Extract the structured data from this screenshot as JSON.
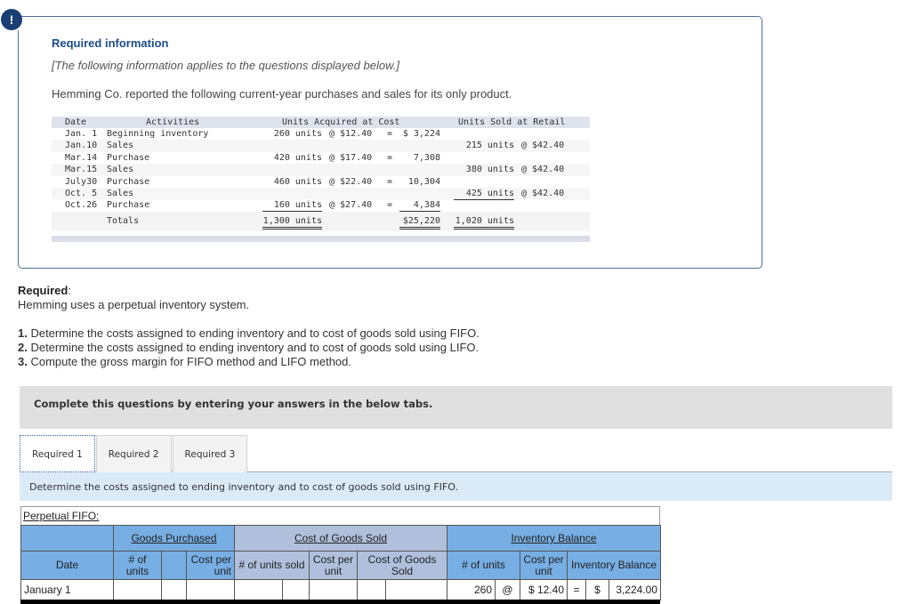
{
  "info": {
    "title": "Required information",
    "note": "[The following information applies to the questions displayed below.]",
    "intro": "Hemming Co. reported the following current-year purchases and sales for its only product."
  },
  "data_table": {
    "headers": {
      "date": "Date",
      "activities": "Activities",
      "acquired": "Units Acquired at Cost",
      "sold": "Units Sold at Retail"
    },
    "rows": [
      {
        "date": "Jan. 1",
        "activity": "Beginning inventory",
        "acq_units": "260 units",
        "acq_at": "@ $12.40",
        "acq_eq": "=",
        "acq_total": "$ 3,224",
        "sold_units": "",
        "sold_at": ""
      },
      {
        "date": "Jan.10",
        "activity": "Sales",
        "acq_units": "",
        "acq_at": "",
        "acq_eq": "",
        "acq_total": "",
        "sold_units": "215 units",
        "sold_at": "@ $42.40"
      },
      {
        "date": "Mar.14",
        "activity": "Purchase",
        "acq_units": "420 units",
        "acq_at": "@ $17.40",
        "acq_eq": "=",
        "acq_total": "7,308",
        "sold_units": "",
        "sold_at": ""
      },
      {
        "date": "Mar.15",
        "activity": "Sales",
        "acq_units": "",
        "acq_at": "",
        "acq_eq": "",
        "acq_total": "",
        "sold_units": "380 units",
        "sold_at": "@ $42.40"
      },
      {
        "date": "July30",
        "activity": "Purchase",
        "acq_units": "460 units",
        "acq_at": "@ $22.40",
        "acq_eq": "=",
        "acq_total": "10,304",
        "sold_units": "",
        "sold_at": ""
      },
      {
        "date": "Oct. 5",
        "activity": "Sales",
        "acq_units": "",
        "acq_at": "",
        "acq_eq": "",
        "acq_total": "",
        "sold_units": "425 units",
        "sold_at": "@ $42.40"
      },
      {
        "date": "Oct.26",
        "activity": "Purchase",
        "acq_units": "160 units",
        "acq_at": "@ $27.40",
        "acq_eq": "=",
        "acq_total": "4,384",
        "sold_units": "",
        "sold_at": ""
      }
    ],
    "totals": {
      "label": "Totals",
      "acq_units": "1,300 units",
      "acq_total": "$25,220",
      "sold_units": "1,020 units"
    }
  },
  "required": {
    "label": "Required",
    "colon": ":",
    "system": "Hemming uses a perpetual inventory system.",
    "steps": [
      {
        "num": "1.",
        "text": " Determine the costs assigned to ending inventory and to cost of goods sold using FIFO."
      },
      {
        "num": "2.",
        "text": " Determine the costs assigned to ending inventory and to cost of goods sold using LIFO."
      },
      {
        "num": "3.",
        "text": " Compute the gross margin for FIFO method and LIFO method."
      }
    ]
  },
  "banner": "Complete this questions by entering your answers in the below tabs.",
  "tabs": [
    {
      "label": "Required 1",
      "active": true
    },
    {
      "label": "Required 2",
      "active": false
    },
    {
      "label": "Required 3",
      "active": false
    }
  ],
  "instruction": "Determine the costs assigned to ending inventory and to cost of goods sold using FIFO.",
  "fifo": {
    "title": "Perpetual FIFO:",
    "groups": {
      "purchased": "Goods Purchased",
      "cogs": "Cost of Goods Sold",
      "balance": "Inventory Balance"
    },
    "columns": {
      "date": "Date",
      "p_units": "# of units",
      "p_cost": "Cost per unit",
      "s_units": "# of units sold",
      "s_cost": "Cost per unit",
      "s_cogs": "Cost of Goods Sold",
      "b_units": "# of units",
      "b_cost": "Cost per unit",
      "b_balance": "Inventory Balance"
    },
    "rows": [
      {
        "date": "January 1",
        "p_units": "",
        "p_cost": "",
        "s_units": "",
        "s_cost": "",
        "s_cogs": "",
        "b_units": "260",
        "b_at": "@",
        "b_cost": "$ 12.40",
        "b_eq": "=",
        "b_dollar": "$",
        "b_balance": "3,224.00"
      }
    ]
  }
}
